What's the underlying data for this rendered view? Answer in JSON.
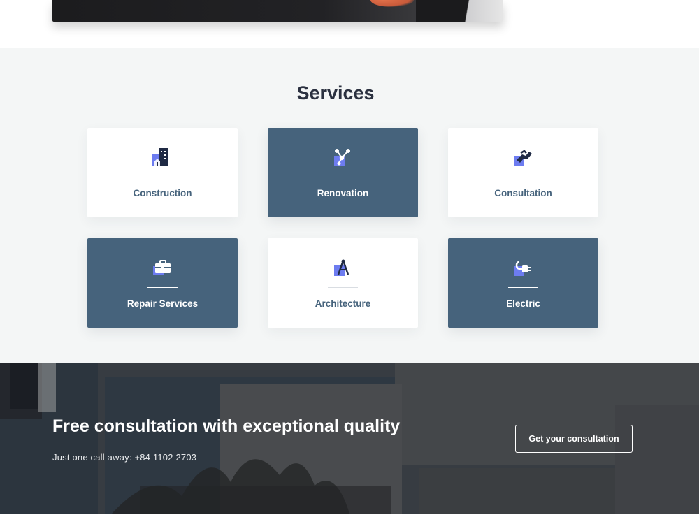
{
  "services": {
    "title": "Services",
    "items": [
      {
        "label": "Construction",
        "icon": "building-icon",
        "style": "light"
      },
      {
        "label": "Renovation",
        "icon": "network-nodes-icon",
        "style": "dark"
      },
      {
        "label": "Consultation",
        "icon": "handshake-icon",
        "style": "light"
      },
      {
        "label": "Repair Services",
        "icon": "toolbox-icon",
        "style": "dark"
      },
      {
        "label": "Architecture",
        "icon": "compass-tool-icon",
        "style": "light"
      },
      {
        "label": "Electric",
        "icon": "power-plug-icon",
        "style": "dark"
      }
    ]
  },
  "cta": {
    "heading": "Free consultation with exceptional quality",
    "phone_text": "Just one call away: +84 1102 2703",
    "button_label": "Get your consultation"
  },
  "colors": {
    "accent_dark": "#46637c",
    "icon_blue": "#6d7cf0",
    "icon_navy": "#1f2a44",
    "section_bg": "#f4f6f6",
    "title_color": "#2b3140"
  }
}
